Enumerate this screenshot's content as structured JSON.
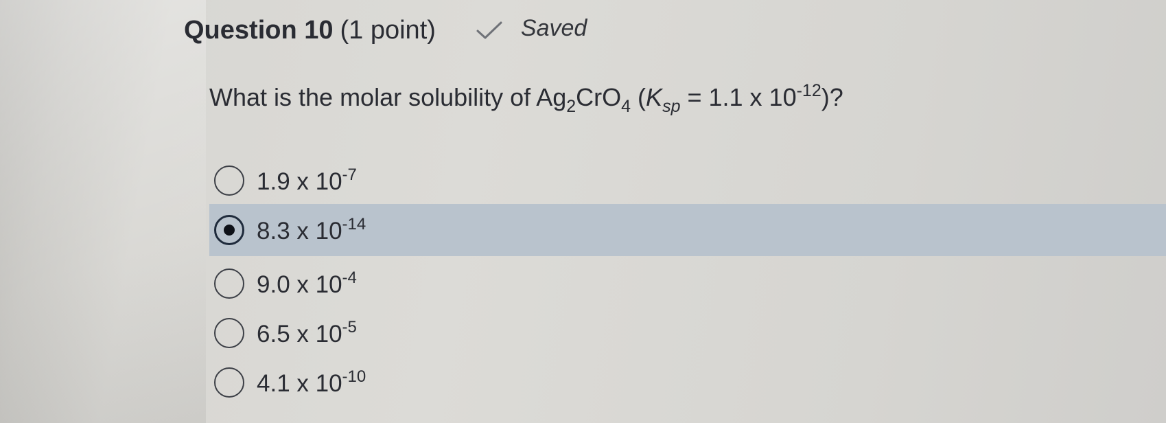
{
  "question": {
    "title": "Question 10",
    "points": "(1 point)",
    "status_icon": "check-icon",
    "status": "Saved",
    "text_prefix": "What is the molar solubility of Ag",
    "text_sub1": "2",
    "text_mid": "CrO",
    "text_sub2": "4",
    "text_paren_open": " (",
    "text_k": "K",
    "text_ksub": "sp",
    "text_eq": " = 1.1 x 10",
    "text_exp": "-12",
    "text_close": ")?"
  },
  "options": [
    {
      "base": "1.9 x 10",
      "exp": "-7",
      "selected": false
    },
    {
      "base": "8.3 x 10",
      "exp": "-14",
      "selected": true
    },
    {
      "base": "9.0 x 10",
      "exp": "-4",
      "selected": false
    },
    {
      "base": "6.5 x 10",
      "exp": "-5",
      "selected": false
    },
    {
      "base": "4.1 x 10",
      "exp": "-10",
      "selected": false
    }
  ],
  "colors": {
    "selected_row": "#b9c3cd",
    "text": "#2a2c33",
    "background": "#dcdbd7"
  }
}
